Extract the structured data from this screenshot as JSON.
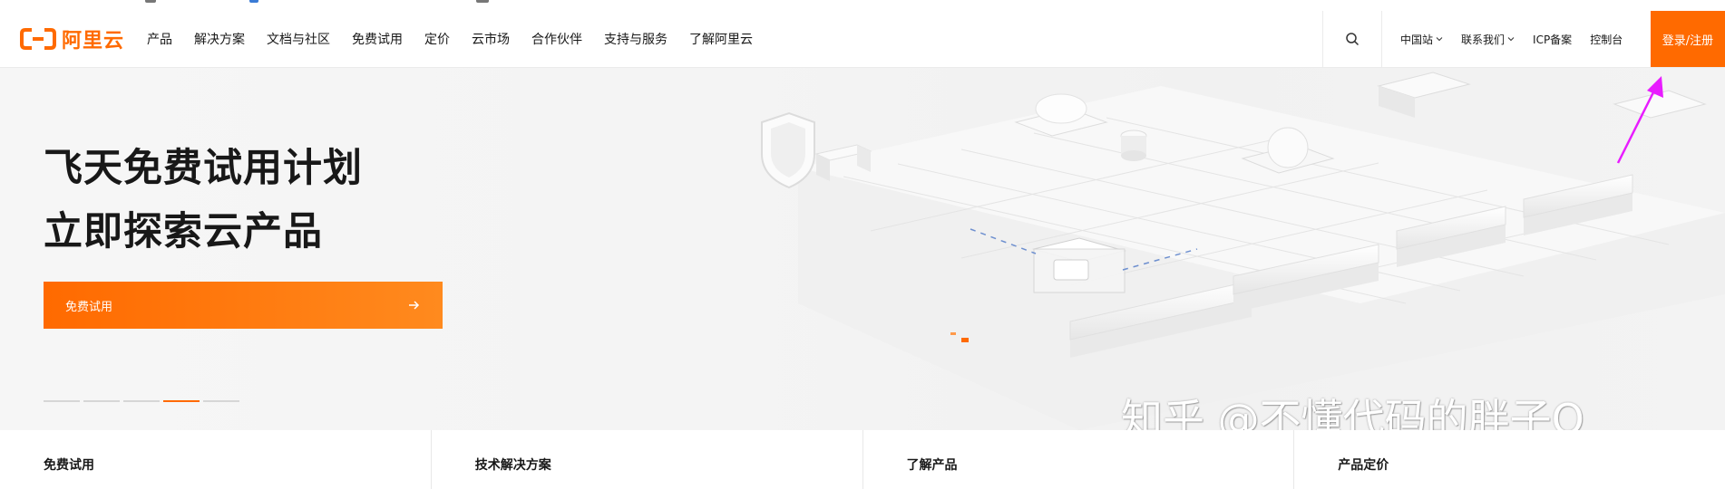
{
  "header": {
    "logo_text": "阿里云",
    "nav": [
      "产品",
      "解决方案",
      "文档与社区",
      "免费试用",
      "定价",
      "云市场",
      "合作伙伴",
      "支持与服务",
      "了解阿里云"
    ],
    "right_nav": {
      "region": "中国站",
      "contact": "联系我们",
      "icp": "ICP备案",
      "console": "控制台"
    },
    "login": "登录/注册"
  },
  "hero": {
    "title_line1": "飞天免费试用计划",
    "title_line2": "立即探索云产品",
    "cta_label": "免费试用",
    "carousel": {
      "total": 5,
      "active_index": 3
    }
  },
  "watermark": "知乎 @不懂代码的胖子Q",
  "cards": [
    "免费试用",
    "技术解决方案",
    "了解产品",
    "产品定价"
  ],
  "colors": {
    "brand": "#ff6a00",
    "annotation_arrow": "#e81cff"
  }
}
